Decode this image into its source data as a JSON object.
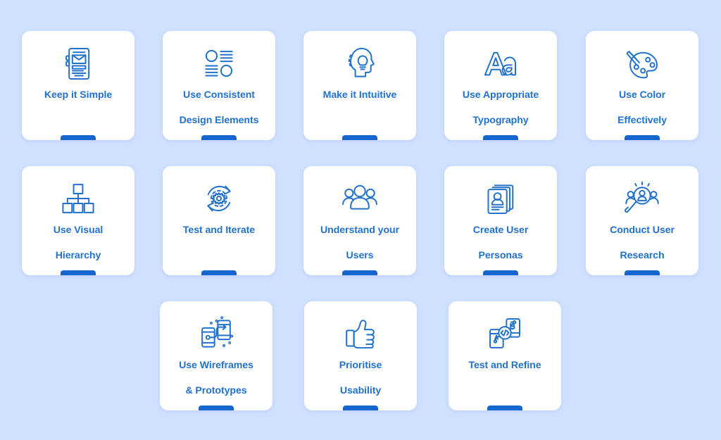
{
  "page": {
    "background_color": "#cfe0ff",
    "card_color": "#ffffff",
    "accent_color": "#1567cf",
    "text_color": "#2272cc"
  },
  "rows": [
    {
      "cards": [
        {
          "icon": "mobile-wireframe-icon",
          "line1": "Keep it Simple",
          "line2": ""
        },
        {
          "icon": "list-layout-icon",
          "line1": "Use Consistent",
          "line2": "Design Elements"
        },
        {
          "icon": "head-lightbulb-icon",
          "line1": "Make it Intuitive",
          "line2": ""
        },
        {
          "icon": "typography-aa-icon",
          "line1": "Use Appropriate",
          "line2": "Typography"
        },
        {
          "icon": "paint-palette-icon",
          "line1": "Use Color",
          "line2": "Effectively"
        }
      ]
    },
    {
      "cards": [
        {
          "icon": "hierarchy-tree-icon",
          "line1": "Use Visual",
          "line2": "Hierarchy"
        },
        {
          "icon": "gear-refresh-icon",
          "line1": "Test and Iterate",
          "line2": ""
        },
        {
          "icon": "user-group-icon",
          "line1": "Understand your",
          "line2": "Users"
        },
        {
          "icon": "persona-cards-icon",
          "line1": "Create User",
          "line2": "Personas"
        },
        {
          "icon": "magnifier-users-icon",
          "line1": "Conduct User",
          "line2": "Research"
        }
      ]
    },
    {
      "cards": [
        {
          "icon": "prototype-phones-icon",
          "line1": "Use Wireframes",
          "line2": "& Prototypes"
        },
        {
          "icon": "thumbs-up-icon",
          "line1": "Prioritise",
          "line2": "Usability"
        },
        {
          "icon": "ab-test-phones-icon",
          "line1": "Test and Refine",
          "line2": ""
        }
      ]
    }
  ]
}
